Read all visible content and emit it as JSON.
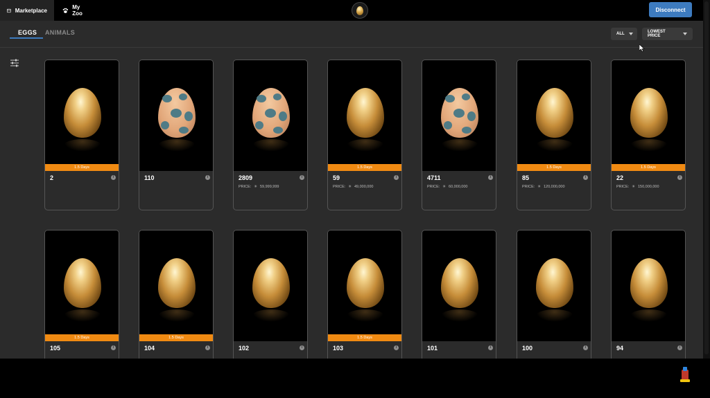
{
  "nav": {
    "tabs": [
      {
        "label": "Marketplace",
        "icon": "store-icon",
        "active": true
      },
      {
        "label": "My Zoo",
        "icon": "paw-icon",
        "active": false
      }
    ],
    "logo_icon": "golden-egg-logo",
    "disconnect_label": "Disconnect"
  },
  "toolbar": {
    "tabs": [
      {
        "label": "EGGS",
        "active": true
      },
      {
        "label": "ANIMALS",
        "active": false
      }
    ],
    "filter_dropdown": "ALL",
    "sort_dropdown": "LOWEST PRICE",
    "filter_icon": "sliders-icon"
  },
  "colors": {
    "accent_blue": "#3d7bbf",
    "days_badge": "#f08a12",
    "background": "#2b2b2b",
    "card_border": "#555555"
  },
  "price_label": "PRICE:",
  "cards": [
    {
      "id": "2",
      "days": "1.5 Days",
      "price": "",
      "egg": "gold"
    },
    {
      "id": "110",
      "days": "",
      "price": "",
      "egg": "spotted"
    },
    {
      "id": "2809",
      "days": "",
      "price": "59,999,999",
      "egg": "spotted"
    },
    {
      "id": "59",
      "days": "1.5 Days",
      "price": "49,000,000",
      "egg": "gold"
    },
    {
      "id": "4711",
      "days": "",
      "price": "60,000,000",
      "egg": "spotted"
    },
    {
      "id": "85",
      "days": "1.5 Days",
      "price": "120,000,000",
      "egg": "gold"
    },
    {
      "id": "22",
      "days": "1.5 Days",
      "price": "150,000,000",
      "egg": "gold"
    },
    {
      "id": "105",
      "days": "1.5 Days",
      "price": "",
      "egg": "gold"
    },
    {
      "id": "104",
      "days": "1.5 Days",
      "price": "",
      "egg": "gold"
    },
    {
      "id": "102",
      "days": "",
      "price": "",
      "egg": "gold"
    },
    {
      "id": "103",
      "days": "1.5 Days",
      "price": "",
      "egg": "gold"
    },
    {
      "id": "101",
      "days": "",
      "price": "",
      "egg": "gold"
    },
    {
      "id": "100",
      "days": "",
      "price": "",
      "egg": "gold"
    },
    {
      "id": "94",
      "days": "",
      "price": "",
      "egg": "gold"
    }
  ]
}
